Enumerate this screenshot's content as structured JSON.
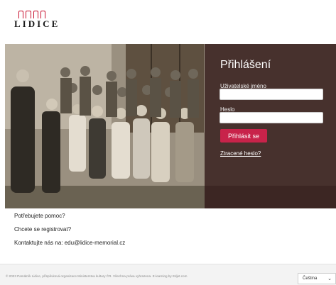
{
  "header": {
    "logo_text": "LIDICE"
  },
  "login": {
    "title": "Přihlášení",
    "username_label": "Uživatelské jméno",
    "username_value": "",
    "password_label": "Heslo",
    "password_value": "",
    "submit_label": "Přihlásit se",
    "forgot_label": "Ztracené heslo?"
  },
  "links": {
    "help": "Potřebujete pomoc?",
    "register": "Chcete se registrovat?",
    "contact": "Kontaktujte nás na: edu@lidice-memorial.cz"
  },
  "footer": {
    "copyright": "© 2023 Památník Lidice, příspěvková organizace Ministerstva kultury ČR. Všechna práva vyhrazena. E-learning by Edjet.com",
    "language": "Čeština"
  },
  "colors": {
    "accent": "#c8234a",
    "panel": "#301616"
  }
}
